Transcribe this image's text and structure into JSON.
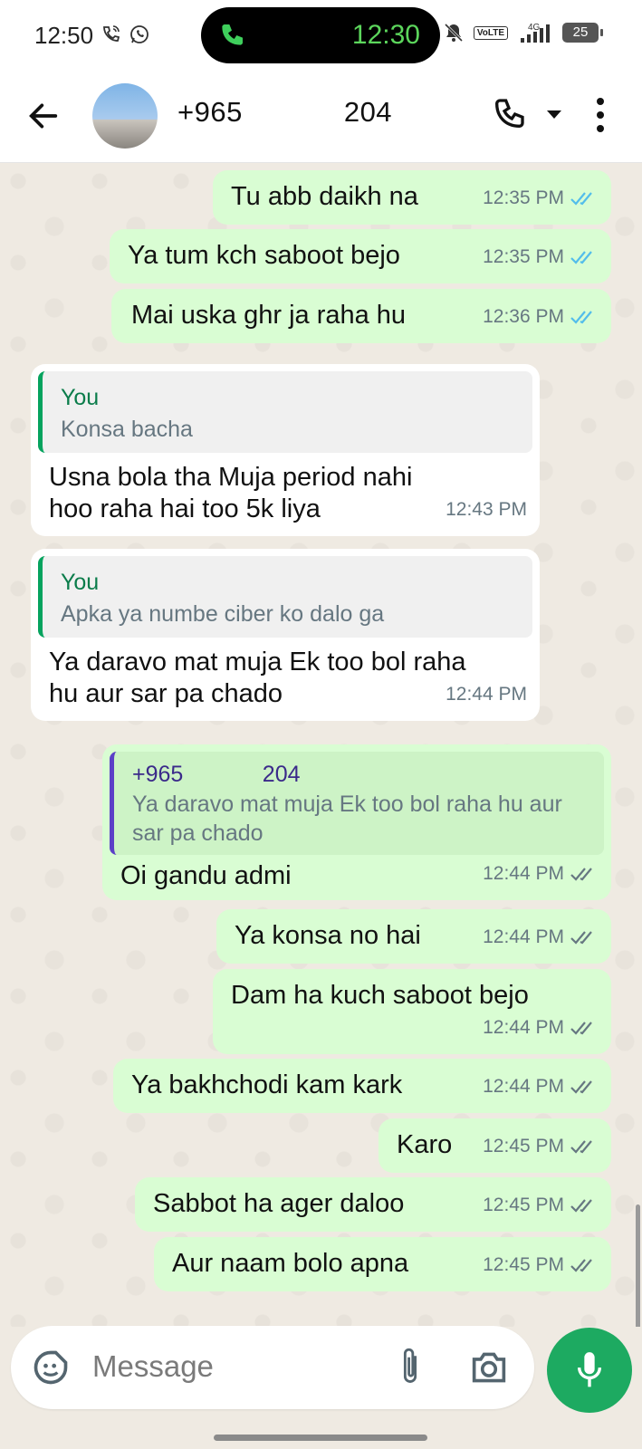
{
  "status_bar": {
    "time": "12:50",
    "left_icons": [
      "wifi-call-icon",
      "whatsapp-icon"
    ],
    "call_pill_time": "12:30",
    "network_badge": "VoLTE",
    "network_type": "4G",
    "battery": "25"
  },
  "header": {
    "contact_name": "+965       204",
    "icons": [
      "back-arrow-icon",
      "call-icon",
      "dropdown-icon",
      "more-icon"
    ]
  },
  "messages": [
    {
      "text": "Tu abb daikh na",
      "time": "12:35 PM",
      "direction": "outgoing",
      "status": "read"
    },
    {
      "text": "Ya tum kch saboot bejo",
      "time": "12:35 PM",
      "direction": "outgoing",
      "status": "read"
    },
    {
      "text": "Mai uska ghr ja raha hu",
      "time": "12:36 PM",
      "direction": "outgoing",
      "status": "read"
    },
    {
      "text": "Usna bola tha Muja period nahi hoo raha hai too 5k liya",
      "time": "12:43 PM",
      "direction": "incoming",
      "quote_name": "You",
      "quote_text": "Konsa bacha"
    },
    {
      "text": "Ya daravo mat muja Ek too bol raha hu aur sar pa chado",
      "time": "12:44 PM",
      "direction": "incoming",
      "quote_name": "You",
      "quote_text": "Apka ya numbe ciber ko dalo ga"
    },
    {
      "text": "Oi gandu admi",
      "time": "12:44 PM",
      "direction": "outgoing",
      "status": "delivered",
      "quote_name": "+965       204",
      "quote_text": "Ya daravo mat muja Ek too bol raha hu aur sar pa chado"
    },
    {
      "text": "Ya konsa no hai",
      "time": "12:44 PM",
      "direction": "outgoing",
      "status": "delivered"
    },
    {
      "text": "Dam ha kuch saboot bejo",
      "time": "12:44 PM",
      "direction": "outgoing",
      "status": "delivered"
    },
    {
      "text": "Ya bakhchodi kam kark",
      "time": "12:44 PM",
      "direction": "outgoing",
      "status": "delivered"
    },
    {
      "text": "Karo",
      "time": "12:45 PM",
      "direction": "outgoing",
      "status": "delivered"
    },
    {
      "text": "Sabbot ha ager daloo",
      "time": "12:45 PM",
      "direction": "outgoing",
      "status": "delivered"
    },
    {
      "text": "Aur naam bolo apna",
      "time": "12:45 PM",
      "direction": "outgoing",
      "status": "delivered"
    }
  ],
  "composer": {
    "placeholder": "Message",
    "icons": [
      "emoji-sticker-icon",
      "attach-icon",
      "camera-icon",
      "mic-icon"
    ]
  },
  "colors": {
    "outgoing_bubble": "#d9fdd3",
    "incoming_bubble": "#ffffff",
    "read_tick": "#53bdeb",
    "accent_green": "#1daa61",
    "chat_background": "#efeae2"
  }
}
